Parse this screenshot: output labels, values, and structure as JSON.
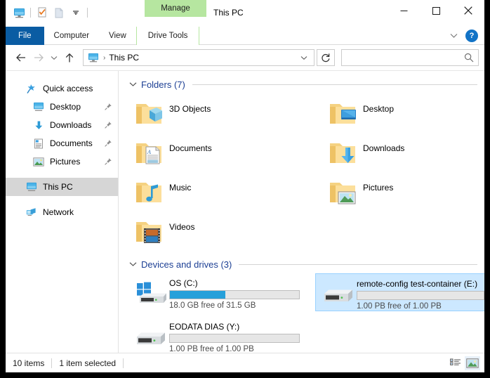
{
  "window": {
    "title": "This PC",
    "contextual_tab_group": "Manage",
    "controls": {
      "minimize": "minimize-button",
      "maximize": "maximize-button",
      "close": "close-button"
    }
  },
  "quick_access_toolbar": {
    "items": [
      {
        "name": "this-pc-icon",
        "label": "This PC"
      },
      {
        "name": "properties-icon",
        "label": "Properties"
      },
      {
        "name": "new-folder-icon",
        "label": "New folder"
      },
      {
        "name": "customize-dropdown-icon",
        "label": "Customize Quick Access Toolbar"
      }
    ]
  },
  "ribbon": {
    "tabs": [
      {
        "id": "file",
        "label": "File",
        "active": false,
        "style": "file"
      },
      {
        "id": "computer",
        "label": "Computer",
        "active": false,
        "style": "normal"
      },
      {
        "id": "view",
        "label": "View",
        "active": false,
        "style": "normal"
      },
      {
        "id": "drive-tools",
        "label": "Drive Tools",
        "active": true,
        "style": "contextual"
      }
    ],
    "collapse_label": "Minimize the Ribbon",
    "help_label": "?"
  },
  "navbar": {
    "back": "Back",
    "forward": "Forward",
    "recent": "Recent locations",
    "up": "Up",
    "address": {
      "icon": "this-pc-icon",
      "path": "This PC",
      "separator": "›"
    },
    "refresh": "Refresh",
    "search": {
      "value": "",
      "placeholder": ""
    }
  },
  "sidebar": {
    "items": [
      {
        "label": "Quick access",
        "icon": "quick-access-star-icon",
        "indent": 0,
        "pinned": false,
        "selected": false
      },
      {
        "label": "Desktop",
        "icon": "desktop-monitor-icon",
        "indent": 1,
        "pinned": true,
        "selected": false
      },
      {
        "label": "Downloads",
        "icon": "downloads-arrow-icon",
        "indent": 1,
        "pinned": true,
        "selected": false
      },
      {
        "label": "Documents",
        "icon": "documents-icon",
        "indent": 1,
        "pinned": true,
        "selected": false
      },
      {
        "label": "Pictures",
        "icon": "pictures-icon",
        "indent": 1,
        "pinned": true,
        "selected": false
      },
      {
        "label": "This PC",
        "icon": "this-pc-icon",
        "indent": 0,
        "pinned": false,
        "selected": true
      },
      {
        "label": "Network",
        "icon": "network-icon",
        "indent": 0,
        "pinned": false,
        "selected": false
      }
    ]
  },
  "content": {
    "groups": [
      {
        "id": "folders",
        "title": "Folders (7)",
        "expanded": true,
        "items": [
          {
            "label": "3D Objects",
            "icon": "folder-3d-objects-icon",
            "column": "left"
          },
          {
            "label": "Desktop",
            "icon": "folder-desktop-icon",
            "column": "right"
          },
          {
            "label": "Documents",
            "icon": "folder-documents-icon",
            "column": "left"
          },
          {
            "label": "Downloads",
            "icon": "folder-downloads-icon",
            "column": "right"
          },
          {
            "label": "Music",
            "icon": "folder-music-icon",
            "column": "left"
          },
          {
            "label": "Pictures",
            "icon": "folder-pictures-icon",
            "column": "right"
          },
          {
            "label": "Videos",
            "icon": "folder-videos-icon",
            "column": "left"
          }
        ]
      },
      {
        "id": "devices",
        "title": "Devices and drives (3)",
        "expanded": true,
        "items": [
          {
            "label": "OS (C:)",
            "icon": "drive-windows-icon",
            "free_text": "18.0 GB free of 31.5 GB",
            "used_percent": 43,
            "bar_visible": true,
            "selected": false,
            "column": "left"
          },
          {
            "label": "remote-config test-container (E:)",
            "icon": "drive-generic-icon",
            "free_text": "1.00 PB free of 1.00 PB",
            "used_percent": 0,
            "bar_visible": true,
            "selected": true,
            "column": "right"
          },
          {
            "label": "EODATA DIAS (Y:)",
            "icon": "drive-generic-icon",
            "free_text": "1.00 PB free of 1.00 PB",
            "used_percent": 0,
            "bar_visible": true,
            "selected": false,
            "column": "left"
          }
        ]
      }
    ]
  },
  "statusbar": {
    "item_count": "10 items",
    "selection": "1 item selected",
    "views": [
      {
        "name": "details-view-button",
        "label": "Details view",
        "active": false
      },
      {
        "name": "large-icons-view-button",
        "label": "Large icons view",
        "active": true
      }
    ]
  },
  "colors": {
    "accent_blue": "#26a0da",
    "file_tab_blue": "#0a5ca3",
    "contextual_green": "#b6e6a0",
    "selection_blue": "#cce8ff",
    "group_header_blue": "#1c3f94"
  }
}
